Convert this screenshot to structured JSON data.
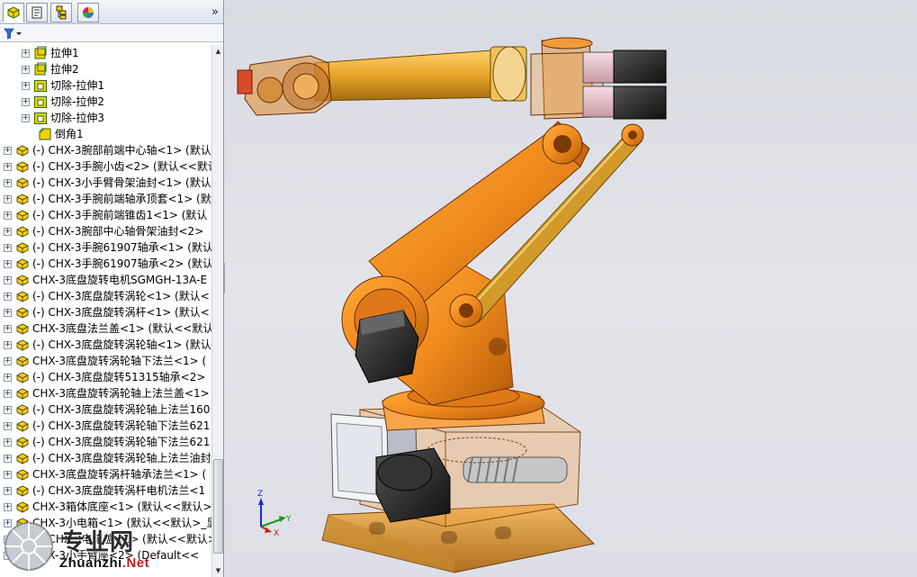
{
  "panel": {
    "tabs": [
      {
        "name": "feature-manager-icon",
        "active": true
      },
      {
        "name": "property-manager-icon",
        "active": false
      },
      {
        "name": "configuration-manager-icon",
        "active": false
      },
      {
        "name": "display-manager-icon",
        "active": false
      }
    ],
    "expand_label": "»",
    "filter_icon": "filter-icon"
  },
  "tree": {
    "items": [
      {
        "label": "拉伸1",
        "indent": 1,
        "icon": "extrude-icon"
      },
      {
        "label": "拉伸2",
        "indent": 1,
        "icon": "extrude-icon"
      },
      {
        "label": "切除-拉伸1",
        "indent": 1,
        "icon": "cut-extrude-icon"
      },
      {
        "label": "切除-拉伸2",
        "indent": 1,
        "icon": "cut-extrude-icon"
      },
      {
        "label": "切除-拉伸3",
        "indent": 1,
        "icon": "cut-extrude-icon"
      },
      {
        "label": "倒角1",
        "indent": 2,
        "icon": "chamfer-icon"
      },
      {
        "label": "(-) CHX-3腕部前端中心轴<1> (默认<<默认",
        "indent": 0,
        "icon": "part-icon"
      },
      {
        "label": "(-) CHX-3手腕小齿<2> (默认<<默认",
        "indent": 0,
        "icon": "part-icon"
      },
      {
        "label": "(-) CHX-3小手臂骨架油封<1> (默认",
        "indent": 0,
        "icon": "part-icon"
      },
      {
        "label": "(-) CHX-3手腕前端轴承顶套<1> (默认",
        "indent": 0,
        "icon": "part-icon"
      },
      {
        "label": "(-) CHX-3手腕前端锥齿1<1> (默认",
        "indent": 0,
        "icon": "part-icon"
      },
      {
        "label": "(-) CHX-3腕部中心轴骨架油封<2>",
        "indent": 0,
        "icon": "part-icon"
      },
      {
        "label": "(-) CHX-3手腕61907轴承<1> (默认",
        "indent": 0,
        "icon": "part-icon"
      },
      {
        "label": "(-) CHX-3手腕61907轴承<2> (默认",
        "indent": 0,
        "icon": "part-icon"
      },
      {
        "label": "CHX-3底盘旋转电机SGMGH-13A-E",
        "indent": 0,
        "icon": "part-icon"
      },
      {
        "label": "(-) CHX-3底盘旋转涡轮<1> (默认<",
        "indent": 0,
        "icon": "part-icon"
      },
      {
        "label": "(-) CHX-3底盘旋转涡杆<1> (默认<",
        "indent": 0,
        "icon": "part-icon"
      },
      {
        "label": "CHX-3底盘法兰盖<1> (默认<<默认",
        "indent": 0,
        "icon": "part-icon"
      },
      {
        "label": "(-) CHX-3底盘旋转涡轮轴<1> (默认",
        "indent": 0,
        "icon": "part-icon"
      },
      {
        "label": "CHX-3底盘旋转涡轮轴下法兰<1> (",
        "indent": 0,
        "icon": "part-icon"
      },
      {
        "label": "(-) CHX-3底盘旋转51315轴承<2>",
        "indent": 0,
        "icon": "part-icon"
      },
      {
        "label": "CHX-3底盘旋转涡轮轴上法兰盖<1>",
        "indent": 0,
        "icon": "part-icon"
      },
      {
        "label": "(-) CHX-3底盘旋转涡轮轴上法兰160",
        "indent": 0,
        "icon": "part-icon"
      },
      {
        "label": "(-) CHX-3底盘旋转涡轮轴下法兰621",
        "indent": 0,
        "icon": "part-icon"
      },
      {
        "label": "(-) CHX-3底盘旋转涡轮轴下法兰621",
        "indent": 0,
        "icon": "part-icon"
      },
      {
        "label": "(-) CHX-3底盘旋转涡轮轴上法兰油封",
        "indent": 0,
        "icon": "part-icon"
      },
      {
        "label": "CHX-3底盘旋转涡杆轴承法兰<1> (",
        "indent": 0,
        "icon": "part-icon"
      },
      {
        "label": "(-) CHX-3底盘旋转涡杆电机法兰<1",
        "indent": 0,
        "icon": "part-icon"
      },
      {
        "label": "CHX-3箱体底座<1> (默认<<默认>",
        "indent": 0,
        "icon": "part-icon"
      },
      {
        "label": "CHX-3小电箱<1> (默认<<默认>_显",
        "indent": 0,
        "icon": "part-icon"
      },
      {
        "label": "(-) CHX-3电箱盖<1> (默认<<默认>",
        "indent": 0,
        "icon": "part-icon"
      },
      {
        "label": "CHX-3小手臂座<2> (Default<<",
        "indent": 0,
        "icon": "part-icon"
      }
    ]
  },
  "triad": {
    "x": "X",
    "y": "Y",
    "z": "Z"
  },
  "watermark": {
    "logo_text": "专业网",
    "url_prefix": "Zhuanzhi",
    "url_suffix": ".Net"
  },
  "colors": {
    "robot_orange": "#f08a1e",
    "robot_dark_orange": "#c8660c",
    "arm_gold": "#e8a62a",
    "motor_black": "#1e1e1e",
    "base_gold": "#d89a3a"
  }
}
